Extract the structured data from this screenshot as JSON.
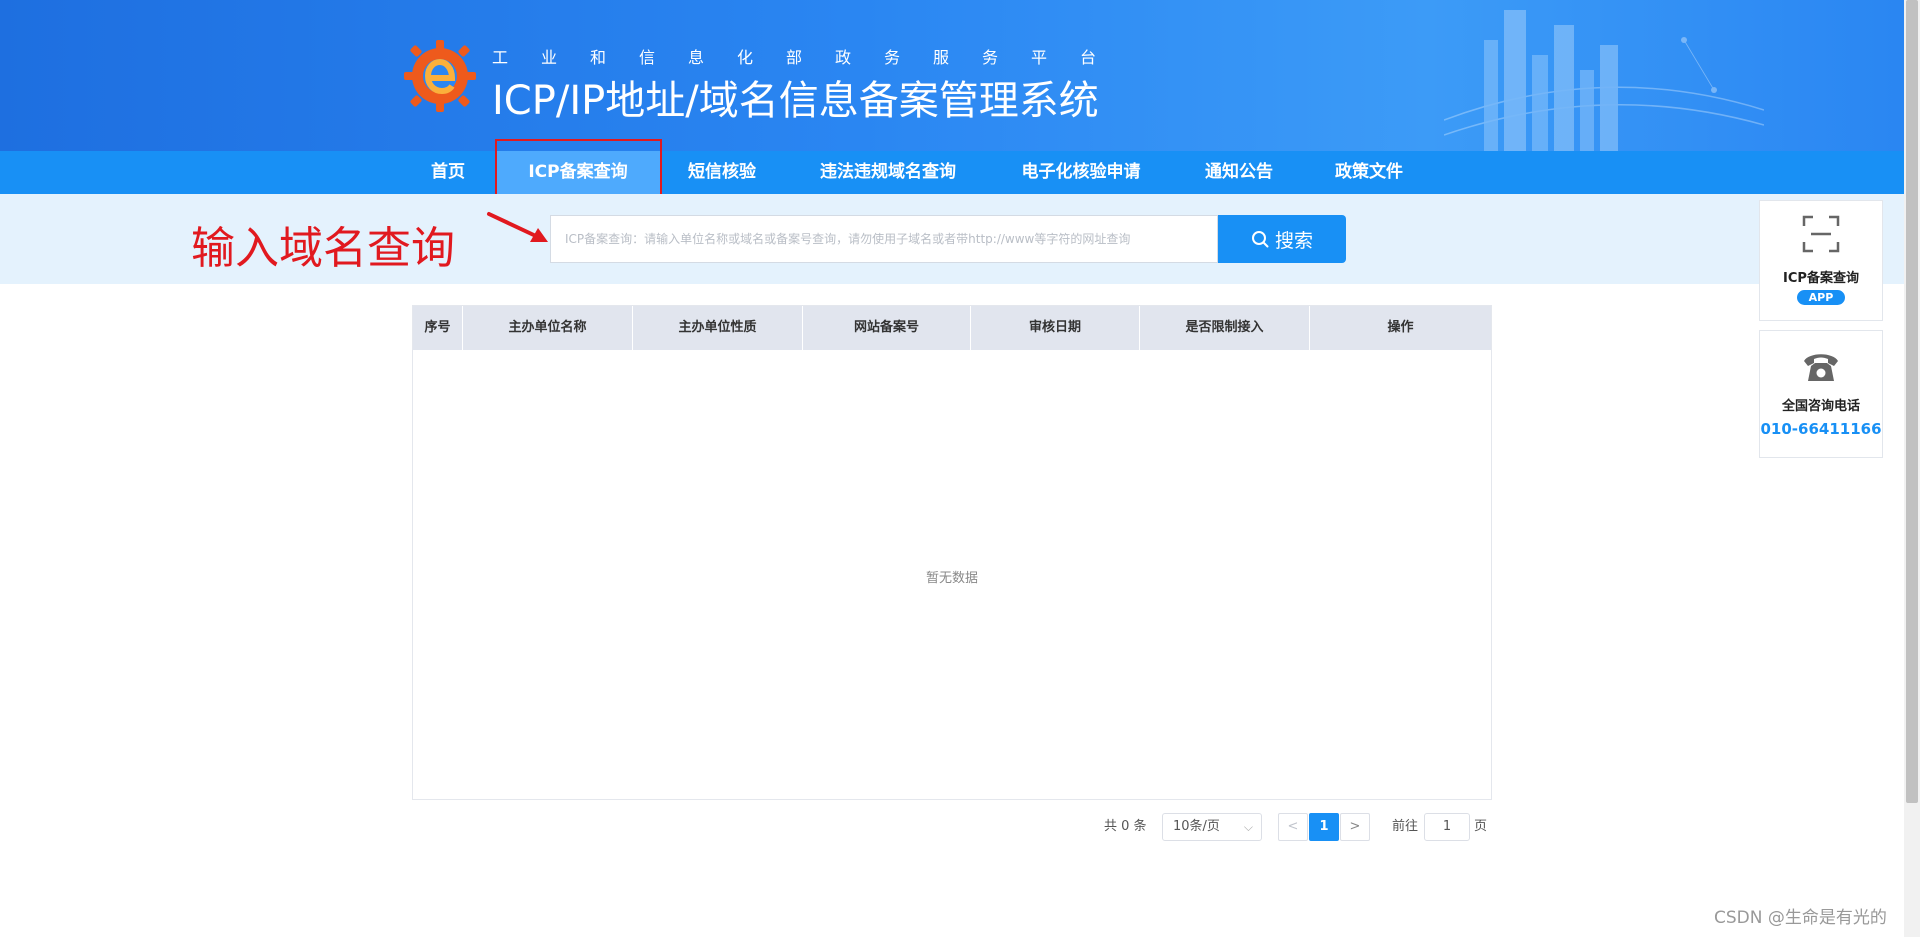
{
  "header": {
    "slogan": "工业和信息化部政务服务平台",
    "title": "ICP/IP地址/域名信息备案管理系统",
    "logo_icon": "gear-e-logo-icon",
    "colors": {
      "bg": "#2a86f2",
      "logo": "#ee5a1c"
    }
  },
  "nav": {
    "items": [
      {
        "label": "首页",
        "active": false
      },
      {
        "label": "ICP备案查询",
        "active": true
      },
      {
        "label": "短信核验",
        "active": false
      },
      {
        "label": "违法违规域名查询",
        "active": false
      },
      {
        "label": "电子化核验申请",
        "active": false
      },
      {
        "label": "通知公告",
        "active": false
      },
      {
        "label": "政策文件",
        "active": false
      }
    ],
    "color": "#1890f5"
  },
  "annotation": {
    "text": "输入域名查询",
    "color": "#e1191f"
  },
  "search": {
    "placeholder": "ICP备案查询：请输入单位名称或域名或备案号查询，请勿使用子域名或者带http://www等字符的网址查询",
    "value": "",
    "button_label": "搜索",
    "button_icon": "search-icon"
  },
  "table": {
    "columns": [
      "序号",
      "主办单位名称",
      "主办单位性质",
      "网站备案号",
      "审核日期",
      "是否限制接入",
      "操作"
    ],
    "rows": [],
    "empty_text": "暂无数据"
  },
  "pagination": {
    "total_text": "共 0 条",
    "page_size": "10条/页",
    "current_page": "1",
    "goto_label": "前往",
    "goto_value": "1",
    "goto_unit": "页"
  },
  "float_panel": {
    "app_card": {
      "icon": "scan-qr-icon",
      "title": "ICP备案查询",
      "badge": "APP"
    },
    "phone_card": {
      "icon": "telephone-icon",
      "title": "全国咨询电话",
      "phone": "010-66411166"
    }
  },
  "watermark": "CSDN @生命是有光的"
}
